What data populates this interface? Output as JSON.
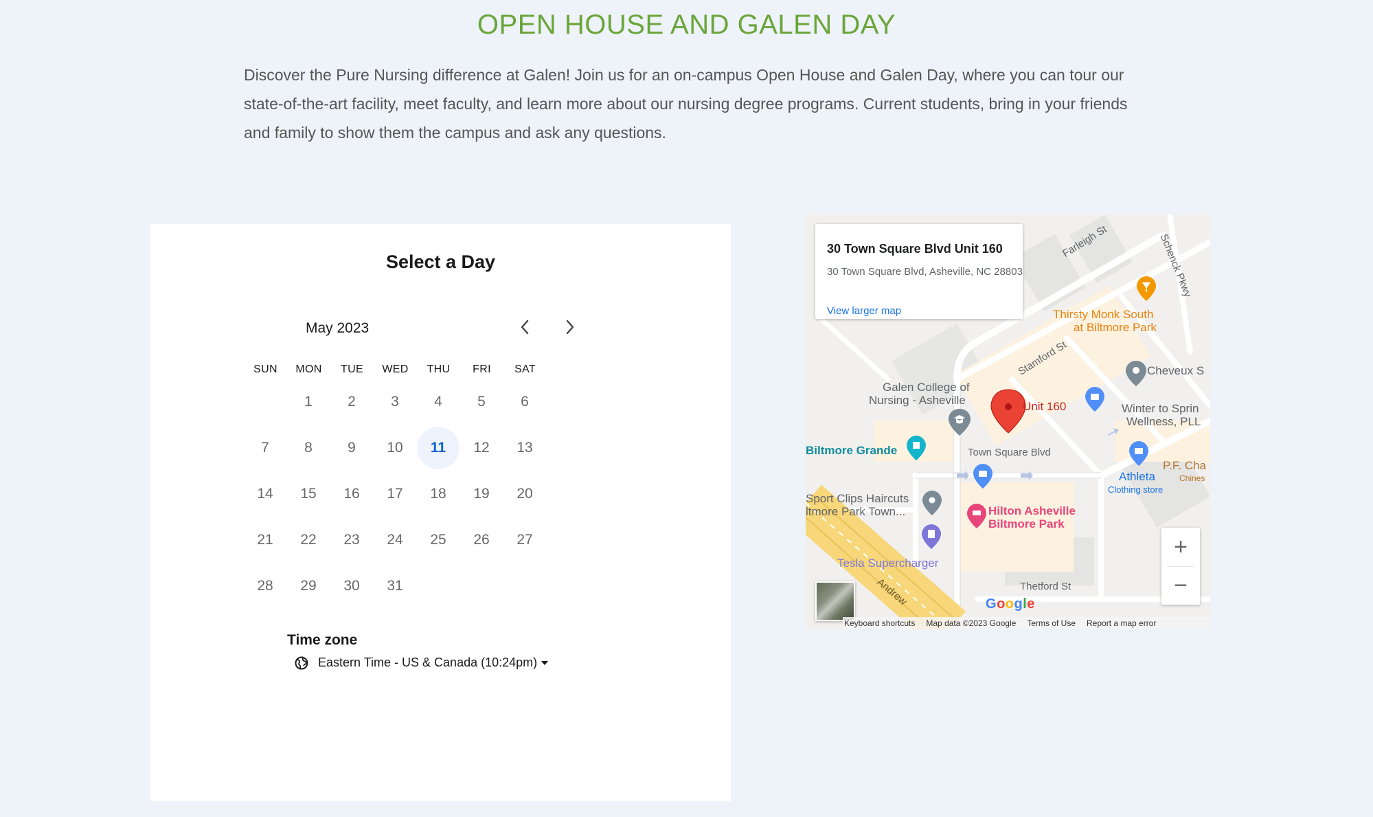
{
  "header": {
    "title": "OPEN HOUSE AND GALEN DAY",
    "intro": "Discover the Pure Nursing difference at Galen! Join us for an on-campus Open House and Galen Day, where you can tour our state-of-the-art facility, meet faculty, and learn more about our nursing degree programs. Current students, bring in your friends and family to show them the campus and ask any questions."
  },
  "calendar": {
    "heading": "Select a Day",
    "month": "May 2023",
    "prev_icon": "chevron-left-icon",
    "next_icon": "chevron-right-icon",
    "weekdays": [
      "SUN",
      "MON",
      "TUE",
      "WED",
      "THU",
      "FRI",
      "SAT"
    ],
    "first_weekday_index": 1,
    "days": [
      "1",
      "2",
      "3",
      "4",
      "5",
      "6",
      "7",
      "8",
      "9",
      "10",
      "11",
      "12",
      "13",
      "14",
      "15",
      "16",
      "17",
      "18",
      "19",
      "20",
      "21",
      "22",
      "23",
      "24",
      "25",
      "26",
      "27",
      "28",
      "29",
      "30",
      "31"
    ],
    "selected_day": "11",
    "timezone_label": "Time zone",
    "timezone_value": "Eastern Time - US & Canada (10:24pm)",
    "timezone_icon": "globe-icon"
  },
  "map": {
    "card": {
      "title": "30 Town Square Blvd Unit 160",
      "address": "30 Town Square Blvd, Asheville, NC 28803",
      "link": "View larger map"
    },
    "labels": {
      "farleigh": "Farleigh St",
      "schenck": "Schenck Pkwy",
      "thirsty1": "Thirsty Monk South",
      "thirsty2": "at Biltmore Park",
      "stamford": "Stamford St",
      "cheveux": "Cheveux S",
      "galen1": "Galen College of",
      "galen2": "Nursing - Asheville",
      "unit": "Unit 160",
      "winter1": "Winter to Sprin",
      "winter2": "Wellness, PLL",
      "biltmore_grande": "Biltmore Grande",
      "town_square": "Town Square Blvd",
      "pf1": "P.F. Cha",
      "pf2": "Chines",
      "athleta": "Athleta",
      "athleta_sub": "Clothing store",
      "sport1": "Sport Clips Haircuts",
      "sport2": "ltmore Park Town...",
      "hilton1": "Hilton Asheville",
      "hilton2": "Biltmore Park",
      "tesla": "Tesla Supercharger",
      "thetford": "Thetford St",
      "andrew": "Andrew"
    },
    "google": "Google",
    "attribution": {
      "shortcuts": "Keyboard shortcuts",
      "data": "Map data ©2023 Google",
      "terms": "Terms of Use",
      "report": "Report a map error"
    },
    "zoom_in": "+",
    "zoom_out": "−",
    "colors": {
      "pin_red": "#ea4335",
      "poi_blue": "#4f8ff7",
      "poi_gray": "#7b8a95",
      "poi_orange": "#f29900",
      "poi_teal": "#12b5cb",
      "poi_pink": "#e8457a",
      "poi_purple": "#7e76d8"
    }
  }
}
